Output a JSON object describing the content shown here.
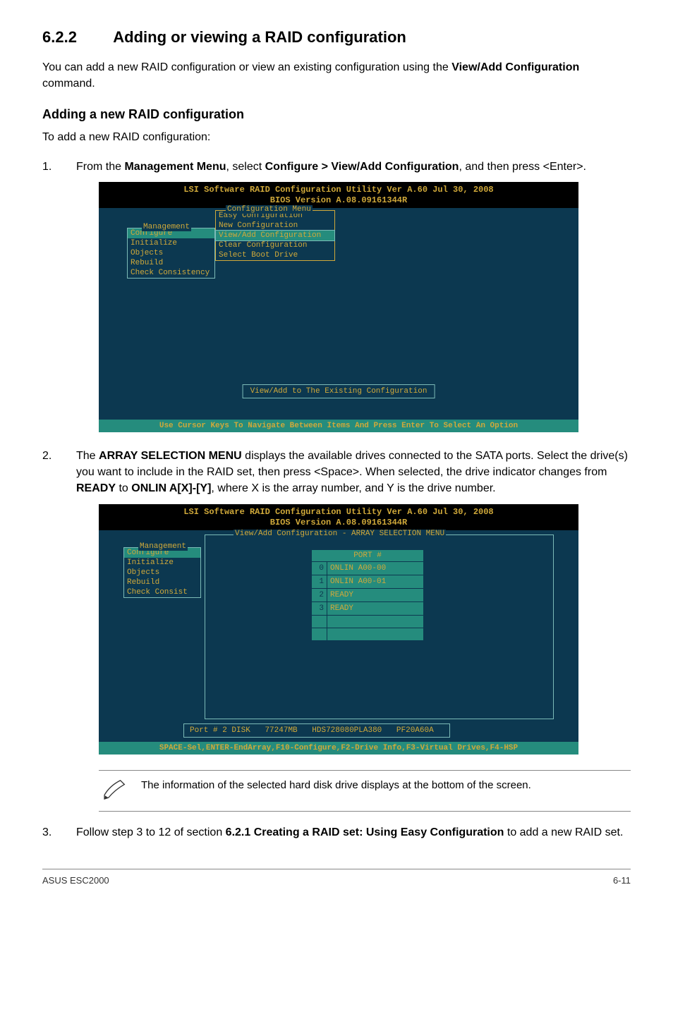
{
  "section": {
    "number": "6.2.2",
    "title": "Adding or viewing a RAID configuration"
  },
  "intro": "You can add a new RAID configuration or view an existing configuration using the View/Add Configuration command.",
  "intro_bold": "View/Add Configuration",
  "subsection_title": "Adding a new RAID configuration",
  "subsection_desc": "To add a new RAID configuration:",
  "steps": {
    "s1_num": "1.",
    "s1_a": "From the ",
    "s1_b": "Management Menu",
    "s1_c": ", select ",
    "s1_d": "Configure > View/Add Configuration",
    "s1_e": ", and then press <Enter>.",
    "s2_num": "2.",
    "s2_a": "The ",
    "s2_b": "ARRAY SELECTION MENU",
    "s2_c": " displays the available drives connected to the SATA ports. Select the drive(s) you want to include in the RAID set, then press <Space>. When selected, the drive indicator changes from ",
    "s2_d": "READY",
    "s2_e": " to ",
    "s2_f": "ONLIN A[X]-[Y]",
    "s2_g": ", where X is the array number, and Y is the drive number.",
    "s3_num": "3.",
    "s3_a": "Follow step 3 to 12 of section ",
    "s3_b": "6.2.1 Creating a RAID set: Using Easy Configuration",
    "s3_c": " to add a new RAID set."
  },
  "bios": {
    "header_line1": "LSI Software RAID Configuration Utility Ver A.60 Jul 30, 2008",
    "header_line2": "BIOS Version   A.08.09161344R",
    "mgmt_label": "Management",
    "mgmt_items": [
      "Configure",
      "Initialize",
      "Objects",
      "Rebuild",
      "Check Consistency"
    ],
    "config_label": "Configuration Menu",
    "config_items": [
      "Easy Configuration",
      "New Configuration",
      "View/Add Configuration",
      "Clear Configuration",
      "Select Boot Drive"
    ],
    "existing_btn": "View/Add to The Existing Configuration",
    "footer1": "Use Cursor Keys To Navigate Between Items And Press Enter To Select An Option"
  },
  "bios2": {
    "array_label": "View/Add Configuration - ARRAY SELECTION MENU",
    "port_header": "PORT #",
    "rows": [
      {
        "idx": "0",
        "status": "ONLIN A00-00"
      },
      {
        "idx": "1",
        "status": "ONLIN A00-01"
      },
      {
        "idx": "2",
        "status": "READY"
      },
      {
        "idx": "3",
        "status": "READY"
      }
    ],
    "mgmt_items2": [
      "Configure",
      "Initialize",
      "Objects",
      "Rebuild",
      "Check Consist"
    ],
    "status_port": "Port # 2 DISK",
    "status_size": "77247MB",
    "status_model": "HDS728080PLA380",
    "status_fw": "PF20A60A",
    "footer2": "SPACE-Sel,ENTER-EndArray,F10-Configure,F2-Drive Info,F3-Virtual Drives,F4-HSP"
  },
  "note_text": "The information of the selected hard disk drive displays at the bottom of the screen.",
  "footer": {
    "left": "ASUS ESC2000",
    "right": "6-11"
  }
}
